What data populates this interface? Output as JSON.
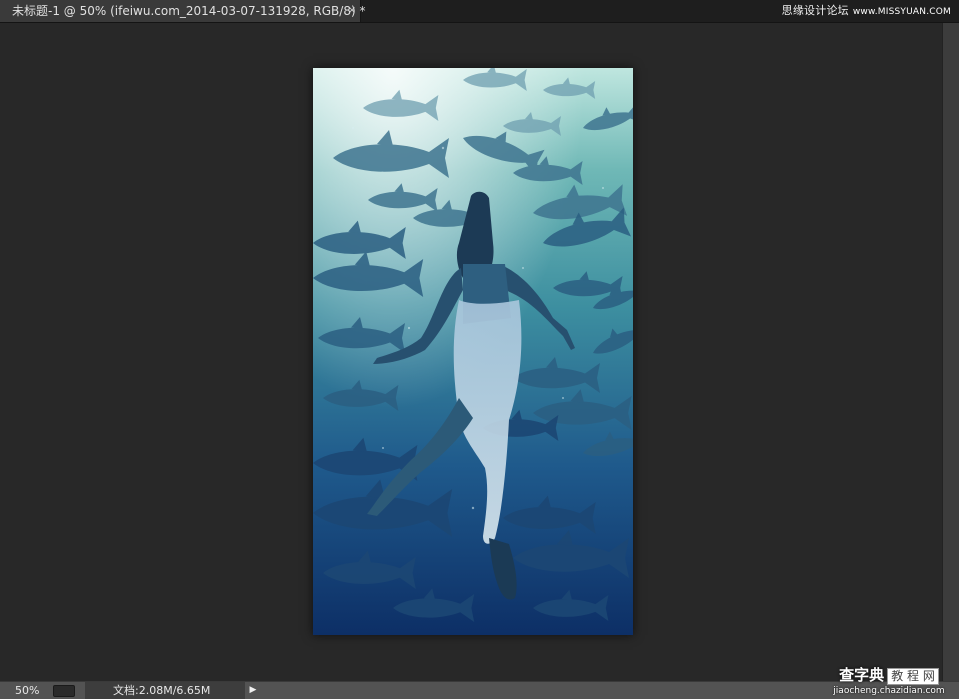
{
  "tab": {
    "title": "未标题-1 @ 50% (ifeiwu.com_2014-03-07-131928, RGB/8) *",
    "close_glyph": "×"
  },
  "watermark_top": {
    "brand": "思缘设计论坛",
    "site": "www.MISSYUAN.COM"
  },
  "canvas": {
    "image": "underwater-woman-swimming-among-tuna-fish",
    "colors": {
      "surface_light": "#bfe6df",
      "mid_teal": "#3d8fa0",
      "mid_blue": "#1f5a8c",
      "deep_blue": "#0d2f66"
    }
  },
  "status": {
    "zoom": "50%",
    "doc_info": "文档:2.08M/6.65M",
    "arrow_glyph": "▶"
  },
  "watermark_bottom": {
    "logo": "查字典",
    "logo_boxed": "教 程 网",
    "url": "jiaocheng.chazidian.com"
  }
}
